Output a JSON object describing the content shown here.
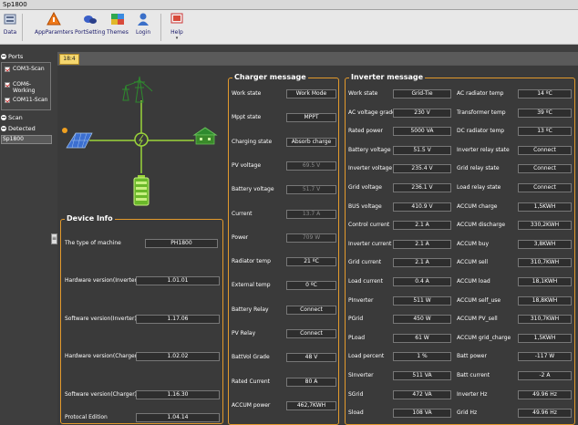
{
  "window": {
    "title": "Sp1800"
  },
  "ribbon": {
    "buttons": [
      {
        "id": "data",
        "label": "Data"
      },
      {
        "id": "appparamters",
        "label": "AppParamters"
      },
      {
        "id": "portsetting",
        "label": "PortSetting"
      },
      {
        "id": "themes",
        "label": "Themes"
      },
      {
        "id": "login",
        "label": "Login"
      },
      {
        "id": "help",
        "label": "Help"
      }
    ]
  },
  "sidebar": {
    "ports_header": "Ports",
    "ports": [
      "COM3-Scan",
      "COM6-Working",
      "COM11-Scan"
    ],
    "scan_header": "Scan",
    "detected_header": "Detected",
    "detected_items": [
      "Sp1800"
    ],
    "collapse_glyph": "≡"
  },
  "tabs": [
    {
      "label": "18:4"
    }
  ],
  "device_info": {
    "title": "Device Info",
    "rows": [
      {
        "label": "The type of machine",
        "value": "PH1800"
      },
      {
        "label": "Hardware version(Inverter)",
        "value": "1.01.01"
      },
      {
        "label": "Software version(Inverter)",
        "value": "1.17.06"
      },
      {
        "label": "Hardware version(Charger)",
        "value": "1.02.02"
      },
      {
        "label": "Software version(Charger)",
        "value": "1.16.30"
      },
      {
        "label": "Protocal Edition",
        "value": "1.04.14"
      }
    ]
  },
  "charger": {
    "title": "Charger message",
    "rows": [
      {
        "label": "Work state",
        "value": "Work Mode",
        "dim": false
      },
      {
        "label": "Mppt state",
        "value": "MPPT",
        "dim": false
      },
      {
        "label": "Charging state",
        "value": "Absorb charge",
        "dim": false
      },
      {
        "label": "PV voltage",
        "value": "69.5 V",
        "dim": true
      },
      {
        "label": "Battery voltage",
        "value": "51.7 V",
        "dim": true
      },
      {
        "label": "Current",
        "value": "13.7 A",
        "dim": true
      },
      {
        "label": "Power",
        "value": "709 W",
        "dim": true
      },
      {
        "label": "Radiator temp",
        "value": "21 ºC",
        "dim": false
      },
      {
        "label": "External temp",
        "value": "0 ºC",
        "dim": false
      },
      {
        "label": "Battery Relay",
        "value": "Connect",
        "dim": false
      },
      {
        "label": "PV Relay",
        "value": "Connect",
        "dim": false
      },
      {
        "label": "BattVol Grade",
        "value": "48 V",
        "dim": false
      },
      {
        "label": "Rated Current",
        "value": "80 A",
        "dim": false
      },
      {
        "label": "ACCUM power",
        "value": "462,7KWH",
        "dim": false
      }
    ]
  },
  "inverter": {
    "title": "Inverter message",
    "left": [
      {
        "label": "Work state",
        "value": "Grid-Tie"
      },
      {
        "label": "AC voltage grade",
        "value": "230 V"
      },
      {
        "label": "Rated power",
        "value": "5000 VA"
      },
      {
        "label": "Battery voltage",
        "value": "51.5 V"
      },
      {
        "label": "Inverter voltage",
        "value": "235.4 V"
      },
      {
        "label": "Grid voltage",
        "value": "236.1 V"
      },
      {
        "label": "BUS voltage",
        "value": "410.9 V"
      },
      {
        "label": "Control current",
        "value": "2.1 A"
      },
      {
        "label": "Inverter current",
        "value": "2.1 A"
      },
      {
        "label": "Grid current",
        "value": "2.1 A"
      },
      {
        "label": "Load current",
        "value": "0.4 A"
      },
      {
        "label": "PInverter",
        "value": "511 W"
      },
      {
        "label": "PGrid",
        "value": "450 W"
      },
      {
        "label": "PLoad",
        "value": "61 W"
      },
      {
        "label": "Load percent",
        "value": "1 %"
      },
      {
        "label": "SInverter",
        "value": "511 VA"
      },
      {
        "label": "SGrid",
        "value": "472 VA"
      },
      {
        "label": "Sload",
        "value": "108 VA"
      }
    ],
    "right": [
      {
        "label": "AC radiator temp",
        "value": "14 ºC"
      },
      {
        "label": "Transformer temp",
        "value": "39 ºC"
      },
      {
        "label": "DC radiator temp",
        "value": "13 ºC"
      },
      {
        "label": "Inverter relay state",
        "value": "Connect"
      },
      {
        "label": "Grid relay state",
        "value": "Connect"
      },
      {
        "label": "Load relay state",
        "value": "Connect"
      },
      {
        "label": "ACCUM charge",
        "value": "1,5KWH"
      },
      {
        "label": "ACCUM discharge",
        "value": "330,2KWH"
      },
      {
        "label": "ACCUM buy",
        "value": "3,8KWH"
      },
      {
        "label": "ACCUM sell",
        "value": "310,7KWH"
      },
      {
        "label": "ACCUM load",
        "value": "18,1KWH"
      },
      {
        "label": "ACCUM self_use",
        "value": "18,8KWH"
      },
      {
        "label": "ACCUM PV_sell",
        "value": "310,7KWH"
      },
      {
        "label": "ACCUM grid_charge",
        "value": "1,5KWH"
      },
      {
        "label": "Batt power",
        "value": "-117 W"
      },
      {
        "label": "Batt current",
        "value": "-2 A"
      },
      {
        "label": "Inverter Hz",
        "value": "49.96 Hz"
      },
      {
        "label": "Grid Hz",
        "value": "49.96 Hz"
      }
    ]
  },
  "colors": {
    "accent": "#e39a2c",
    "flow_line": "#9bd43a",
    "background": "#3e3e3e"
  }
}
